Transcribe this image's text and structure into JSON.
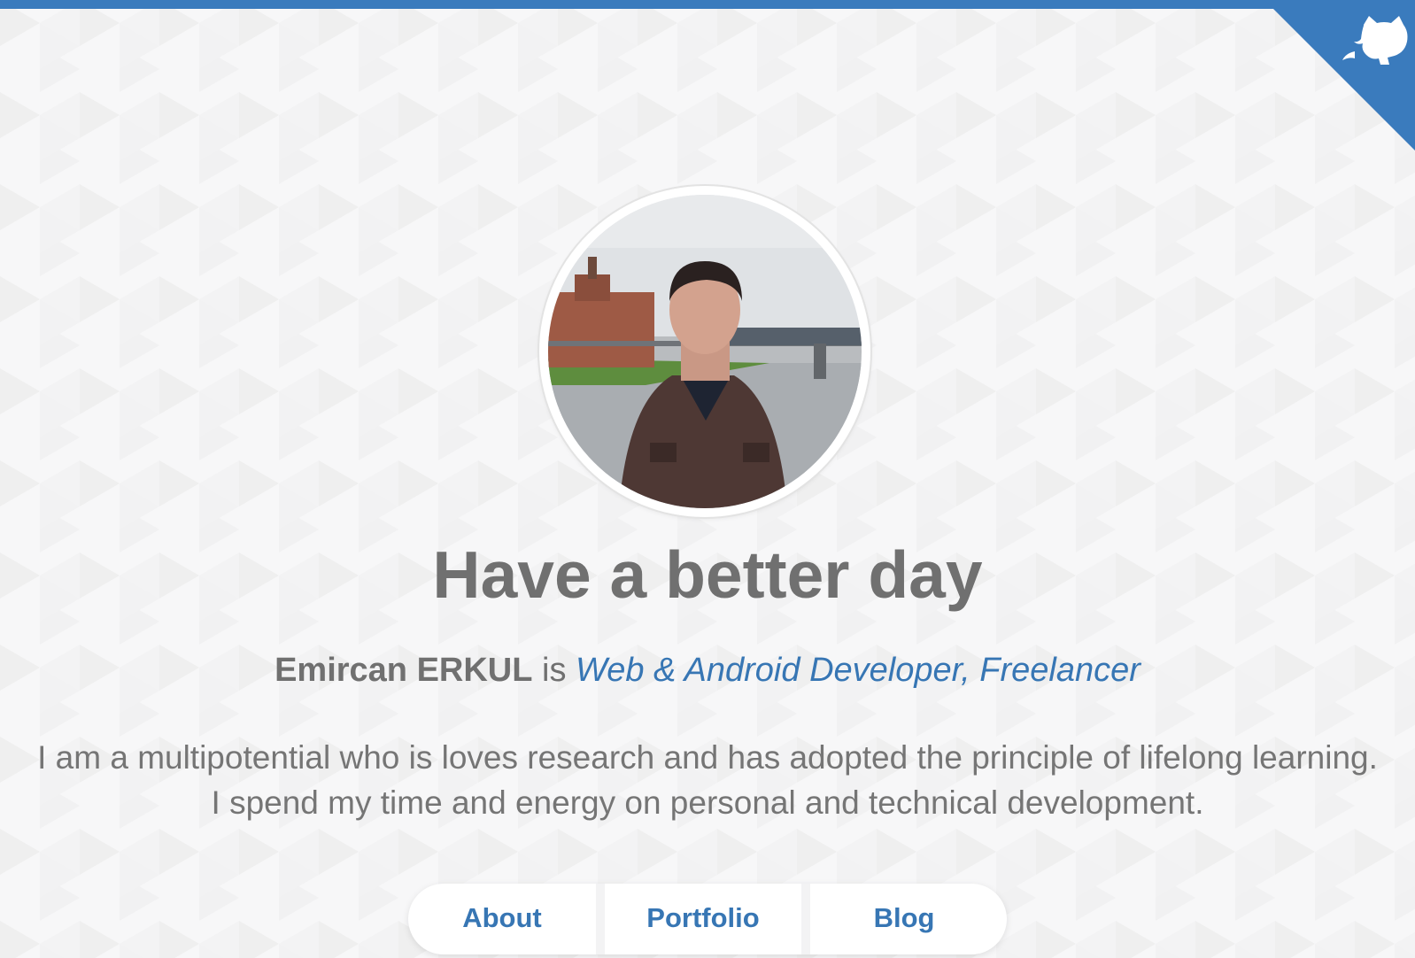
{
  "heading": "Have a better day",
  "tagline": {
    "name": "Emircan ERKUL",
    "connector": " is ",
    "role": "Web & Android Developer, Freelancer"
  },
  "bio": "I am a multipotential who is loves research and has adopted the principle of lifelong learning. I spend my time and energy on personal and technical development.",
  "nav": {
    "items": [
      {
        "label": "About"
      },
      {
        "label": "Portfolio"
      },
      {
        "label": "Blog"
      }
    ]
  },
  "icons": {
    "corner": "github-octocat-icon"
  },
  "colors": {
    "accent": "#3a7bbd",
    "link": "#3776b4",
    "text": "#707070",
    "background": "#f7f7f8"
  }
}
